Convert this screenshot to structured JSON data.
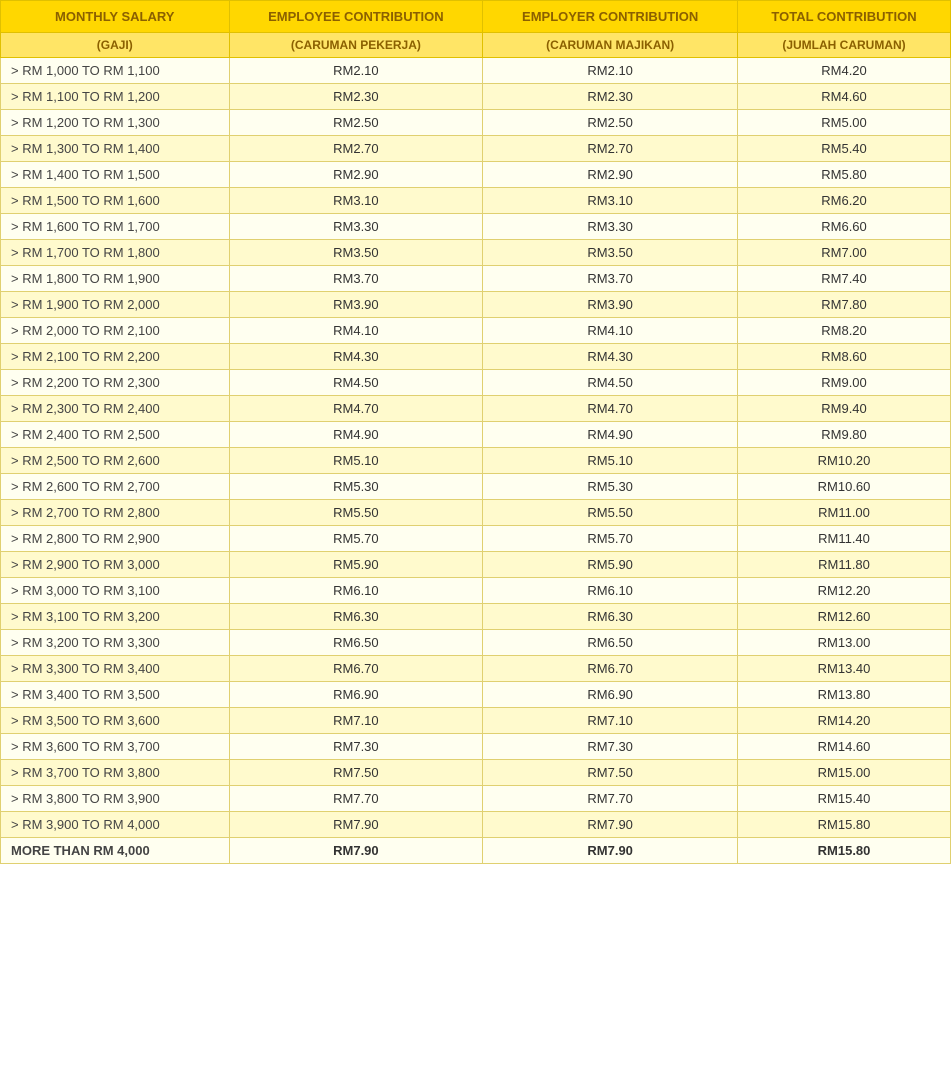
{
  "headers": {
    "col1": "MONTHLY SALARY",
    "col1_sub": "(GAJI)",
    "col2": "EMPLOYEE CONTRIBUTION",
    "col2_sub": "(CARUMAN PEKERJA)",
    "col3": "EMPLOYER CONTRIBUTION",
    "col3_sub": "(CARUMAN MAJIKAN)",
    "col4": "TOTAL CONTRIBUTION",
    "col4_sub": "(JUMLAH CARUMAN)"
  },
  "rows": [
    {
      "salary": "> RM 1,000 TO RM 1,100",
      "employee": "RM2.10",
      "employer": "RM2.10",
      "total": "RM4.20"
    },
    {
      "salary": "> RM 1,100 TO RM 1,200",
      "employee": "RM2.30",
      "employer": "RM2.30",
      "total": "RM4.60"
    },
    {
      "salary": "> RM 1,200 TO RM 1,300",
      "employee": "RM2.50",
      "employer": "RM2.50",
      "total": "RM5.00"
    },
    {
      "salary": "> RM 1,300 TO RM 1,400",
      "employee": "RM2.70",
      "employer": "RM2.70",
      "total": "RM5.40"
    },
    {
      "salary": "> RM 1,400 TO RM 1,500",
      "employee": "RM2.90",
      "employer": "RM2.90",
      "total": "RM5.80"
    },
    {
      "salary": "> RM 1,500 TO RM 1,600",
      "employee": "RM3.10",
      "employer": "RM3.10",
      "total": "RM6.20"
    },
    {
      "salary": "> RM 1,600 TO RM 1,700",
      "employee": "RM3.30",
      "employer": "RM3.30",
      "total": "RM6.60"
    },
    {
      "salary": "> RM 1,700 TO RM 1,800",
      "employee": "RM3.50",
      "employer": "RM3.50",
      "total": "RM7.00"
    },
    {
      "salary": "> RM 1,800 TO RM 1,900",
      "employee": "RM3.70",
      "employer": "RM3.70",
      "total": "RM7.40"
    },
    {
      "salary": "> RM 1,900 TO RM 2,000",
      "employee": "RM3.90",
      "employer": "RM3.90",
      "total": "RM7.80"
    },
    {
      "salary": "> RM 2,000 TO RM 2,100",
      "employee": "RM4.10",
      "employer": "RM4.10",
      "total": "RM8.20"
    },
    {
      "salary": "> RM 2,100 TO RM 2,200",
      "employee": "RM4.30",
      "employer": "RM4.30",
      "total": "RM8.60"
    },
    {
      "salary": "> RM 2,200 TO RM 2,300",
      "employee": "RM4.50",
      "employer": "RM4.50",
      "total": "RM9.00"
    },
    {
      "salary": "> RM 2,300 TO RM 2,400",
      "employee": "RM4.70",
      "employer": "RM4.70",
      "total": "RM9.40"
    },
    {
      "salary": "> RM 2,400 TO RM 2,500",
      "employee": "RM4.90",
      "employer": "RM4.90",
      "total": "RM9.80"
    },
    {
      "salary": "> RM 2,500 TO RM 2,600",
      "employee": "RM5.10",
      "employer": "RM5.10",
      "total": "RM10.20"
    },
    {
      "salary": "> RM 2,600 TO RM 2,700",
      "employee": "RM5.30",
      "employer": "RM5.30",
      "total": "RM10.60"
    },
    {
      "salary": "> RM 2,700 TO RM 2,800",
      "employee": "RM5.50",
      "employer": "RM5.50",
      "total": "RM11.00"
    },
    {
      "salary": "> RM 2,800 TO RM 2,900",
      "employee": "RM5.70",
      "employer": "RM5.70",
      "total": "RM11.40"
    },
    {
      "salary": "> RM 2,900 TO RM 3,000",
      "employee": "RM5.90",
      "employer": "RM5.90",
      "total": "RM11.80"
    },
    {
      "salary": "> RM 3,000 TO RM 3,100",
      "employee": "RM6.10",
      "employer": "RM6.10",
      "total": "RM12.20"
    },
    {
      "salary": "> RM 3,100 TO RM 3,200",
      "employee": "RM6.30",
      "employer": "RM6.30",
      "total": "RM12.60"
    },
    {
      "salary": "> RM 3,200 TO RM 3,300",
      "employee": "RM6.50",
      "employer": "RM6.50",
      "total": "RM13.00"
    },
    {
      "salary": "> RM 3,300 TO RM 3,400",
      "employee": "RM6.70",
      "employer": "RM6.70",
      "total": "RM13.40"
    },
    {
      "salary": "> RM 3,400 TO RM 3,500",
      "employee": "RM6.90",
      "employer": "RM6.90",
      "total": "RM13.80"
    },
    {
      "salary": "> RM 3,500 TO RM 3,600",
      "employee": "RM7.10",
      "employer": "RM7.10",
      "total": "RM14.20"
    },
    {
      "salary": "> RM 3,600 TO RM 3,700",
      "employee": "RM7.30",
      "employer": "RM7.30",
      "total": "RM14.60"
    },
    {
      "salary": "> RM 3,700 TO RM 3,800",
      "employee": "RM7.50",
      "employer": "RM7.50",
      "total": "RM15.00"
    },
    {
      "salary": "> RM 3,800 TO RM 3,900",
      "employee": "RM7.70",
      "employer": "RM7.70",
      "total": "RM15.40"
    },
    {
      "salary": "> RM 3,900 TO RM 4,000",
      "employee": "RM7.90",
      "employer": "RM7.90",
      "total": "RM15.80"
    },
    {
      "salary": "MORE THAN RM 4,000",
      "employee": "RM7.90",
      "employer": "RM7.90",
      "total": "RM15.80"
    }
  ]
}
